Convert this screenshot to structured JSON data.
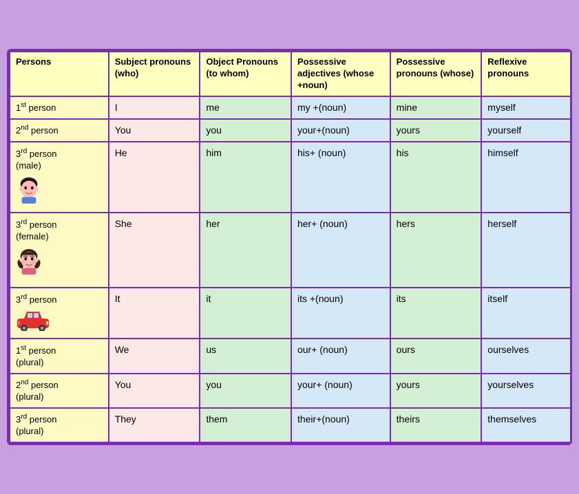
{
  "header": {
    "col0": "Persons",
    "col1": "Subject pronouns (who)",
    "col2": "Object Pronouns (to whom)",
    "col3": "Possessive adjectives (whose +noun)",
    "col4": "Possessive pronouns (whose)",
    "col5": "Reflexive pronouns"
  },
  "rows": [
    {
      "person": "1st person",
      "person_sup": "st",
      "person_base": "1",
      "person_extra": "",
      "has_icon": false,
      "subject": "I",
      "object": "me",
      "poss_adj": "my +(noun)",
      "poss_pro": "mine",
      "reflexive": "myself"
    },
    {
      "person": "2nd person",
      "person_sup": "nd",
      "person_base": "2",
      "person_extra": "",
      "has_icon": false,
      "subject": "You",
      "object": "you",
      "poss_adj": "your+(noun)",
      "poss_pro": "yours",
      "reflexive": "yourself"
    },
    {
      "person": "3rd person (male)",
      "person_sup": "rd",
      "person_base": "3",
      "person_extra": "(male)",
      "has_icon": "boy",
      "subject": "He",
      "object": "him",
      "poss_adj": "his+ (noun)",
      "poss_pro": "his",
      "reflexive": "himself"
    },
    {
      "person": "3rd person (female)",
      "person_sup": "rd",
      "person_base": "3",
      "person_extra": "(female)",
      "has_icon": "girl",
      "subject": "She",
      "object": "her",
      "poss_adj": "her+ (noun)",
      "poss_pro": "hers",
      "reflexive": "herself"
    },
    {
      "person": "3rd person",
      "person_sup": "rd",
      "person_base": "3",
      "person_extra": "",
      "has_icon": "car",
      "subject": "It",
      "object": "it",
      "poss_adj": "its +(noun)",
      "poss_pro": "its",
      "reflexive": "itself"
    },
    {
      "person": "1st person (plural)",
      "person_sup": "st",
      "person_base": "1",
      "person_extra": "(plural)",
      "has_icon": false,
      "subject": "We",
      "object": "us",
      "poss_adj": "our+ (noun)",
      "poss_pro": "ours",
      "reflexive": "ourselves"
    },
    {
      "person": "2nd person (plural)",
      "person_sup": "nd",
      "person_base": "2",
      "person_extra": "(plural)",
      "has_icon": false,
      "subject": "You",
      "object": "you",
      "poss_adj": "your+ (noun)",
      "poss_pro": "yours",
      "reflexive": "yourselves"
    },
    {
      "person": "3rd person (plural)",
      "person_sup": "rd",
      "person_base": "3",
      "person_extra": "(plural)",
      "has_icon": false,
      "subject": "They",
      "object": "them",
      "poss_adj": "their+(noun)",
      "poss_pro": "theirs",
      "reflexive": "themselves"
    }
  ]
}
